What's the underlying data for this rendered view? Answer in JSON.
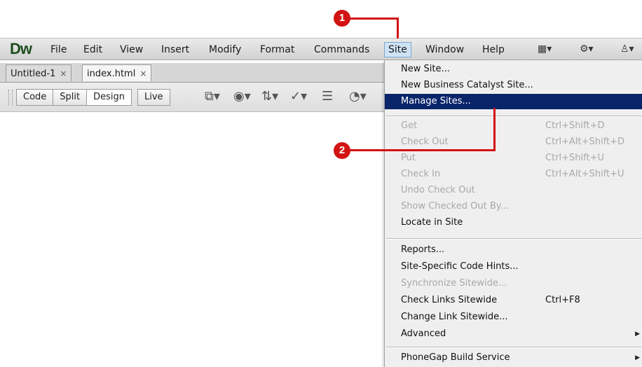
{
  "app": {
    "logo": "Dw"
  },
  "menubar": {
    "items": [
      "File",
      "Edit",
      "View",
      "Insert",
      "Modify",
      "Format",
      "Commands",
      "Site",
      "Window",
      "Help"
    ],
    "active": "Site",
    "icons": [
      "layout-icon",
      "gear-icon",
      "user-icon"
    ]
  },
  "tabs": [
    {
      "label": "Untitled-1",
      "close": "×"
    },
    {
      "label": "index.html",
      "close": "×"
    }
  ],
  "toolbar": {
    "view_buttons": [
      "Code",
      "Split",
      "Design",
      "Live"
    ],
    "selected": "Design",
    "tool_icons": [
      "multiscreen-icon",
      "preview-browser-icon",
      "file-management-icon",
      "w3c-validation-icon",
      "check-browser-icon",
      "visual-aids-icon"
    ]
  },
  "site_menu": {
    "items": [
      {
        "label": "New Site...",
        "shortcut": "",
        "state": "enabled"
      },
      {
        "label": "New Business Catalyst Site...",
        "shortcut": "",
        "state": "enabled"
      },
      {
        "label": "Manage Sites...",
        "shortcut": "",
        "state": "highlighted"
      },
      {
        "label": "Get",
        "shortcut": "Ctrl+Shift+D",
        "state": "disabled"
      },
      {
        "label": "Check Out",
        "shortcut": "Ctrl+Alt+Shift+D",
        "state": "disabled"
      },
      {
        "label": "Put",
        "shortcut": "Ctrl+Shift+U",
        "state": "disabled"
      },
      {
        "label": "Check In",
        "shortcut": "Ctrl+Alt+Shift+U",
        "state": "disabled"
      },
      {
        "label": "Undo Check Out",
        "shortcut": "",
        "state": "disabled"
      },
      {
        "label": "Show Checked Out By...",
        "shortcut": "",
        "state": "disabled"
      },
      {
        "label": "Locate in Site",
        "shortcut": "",
        "state": "enabled"
      },
      {
        "label": "Reports...",
        "shortcut": "",
        "state": "enabled"
      },
      {
        "label": "Site-Specific Code Hints...",
        "shortcut": "",
        "state": "enabled"
      },
      {
        "label": "Synchronize Sitewide...",
        "shortcut": "",
        "state": "disabled"
      },
      {
        "label": "Check Links Sitewide",
        "shortcut": "Ctrl+F8",
        "state": "enabled"
      },
      {
        "label": "Change Link Sitewide...",
        "shortcut": "",
        "state": "enabled"
      },
      {
        "label": "Advanced",
        "shortcut": "",
        "state": "submenu"
      },
      {
        "label": "PhoneGap Build Service",
        "shortcut": "",
        "state": "submenu"
      }
    ]
  },
  "callouts": [
    "1",
    "2"
  ],
  "colors": {
    "callout": "#d21313",
    "highlight": "#0a246a",
    "disabled_text": "#a8a8a8"
  }
}
